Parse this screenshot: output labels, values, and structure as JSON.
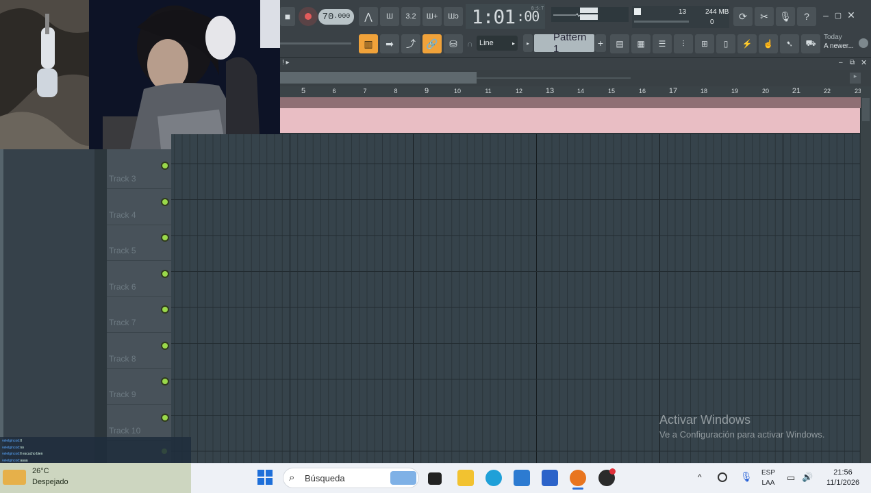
{
  "toolbar": {
    "tempo_main": "70",
    "tempo_frac": ".000",
    "time_main": "1:01",
    "time_sub": ":00",
    "time_tag": "B:S:T",
    "cpu_value": "13",
    "ram_value": "244 MB",
    "poly_value": "0",
    "snap_label": "Line",
    "pattern_label": "Pattern 1",
    "hint_line1": "Today",
    "hint_line2": "A newer...",
    "accent_color": "#f0a23a"
  },
  "playlist": {
    "ruler_numbers": [
      "5",
      "6",
      "7",
      "8",
      "9",
      "10",
      "11",
      "12",
      "13",
      "14",
      "15",
      "16",
      "17",
      "18",
      "19",
      "20",
      "21",
      "22",
      "23"
    ],
    "tracks": [
      "Track 3",
      "Track 4",
      "Track 5",
      "Track 6",
      "Track 7",
      "Track 8",
      "Track 9",
      "Track 10"
    ],
    "clip_color": "#e9bec4"
  },
  "chat": {
    "lines": [
      {
        "user": "velelgincod:",
        "msg": "0"
      },
      {
        "user": "velelgincod:",
        "msg": "no"
      },
      {
        "user": "velelgincod:",
        "msg": "ll escucho bien"
      },
      {
        "user": "velelgincod:",
        "msg": "aaaa"
      },
      {
        "user": "velelgincod:",
        "msg": "ok grupo"
      }
    ]
  },
  "watermark": {
    "title": "Activar Windows",
    "subtitle": "Ve a Configuración para activar Windows."
  },
  "taskbar": {
    "weather_temp": "26°C",
    "weather_desc": "Despejado",
    "search_placeholder": "Búsqueda",
    "lang_line1": "ESP",
    "lang_line2": "LAA",
    "clock_time": "21:56",
    "clock_date": "11/1/2026"
  }
}
